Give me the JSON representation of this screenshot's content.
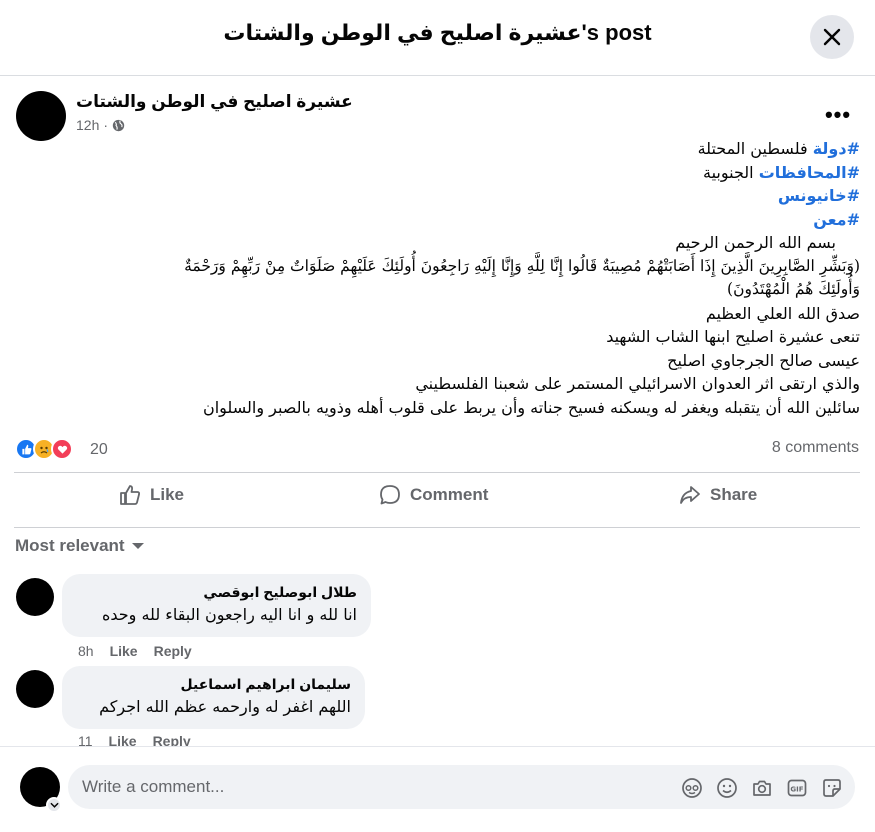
{
  "header": {
    "title": "عشيرة اصليح في الوطن والشتات's post"
  },
  "post": {
    "author": "عشيرة اصليح في الوطن والشتات",
    "time": "12h",
    "hashtags": [
      "#دولة",
      "#المحافظات",
      "#خانيونس",
      "#معن"
    ],
    "hashtag_suffix": [
      " فلسطين المحتلة",
      " الجنوبية",
      "",
      ""
    ],
    "lines": [
      "بسم الله الرحمن الرحيم",
      "(وَبَشِّرِ الصَّابِرِينَ الَّذِينَ إِذَا أَصَابَتْهُمْ مُصِيبَةٌ قَالُوا إِنَّا لِلَّهِ وَإِنَّا إِلَيْهِ رَاجِعُونَ أُولَئِكَ عَلَيْهِمْ صَلَوَاتٌ مِنْ رَبِّهِمْ وَرَحْمَةٌ",
      "وَأُولَئِكَ هُمُ الْمُهْتَدُونَ)",
      "صدق الله العلي العظيم",
      "تنعى  عشيرة اصليح ابنها الشاب الشهيد",
      "عيسى صالح  الجرجاوي اصليح",
      "والذي ارتقى اثر العدوان الاسرائيلي المستمر على شعبنا الفلسطيني",
      "سائلين الله أن يتقبله  ويغفر له ويسكنه فسيح جناته  وأن يربط على قلوب أهله وذويه بالصبر والسلوان"
    ]
  },
  "stats": {
    "reactions": "20",
    "comments": "8 comments"
  },
  "actions": {
    "like": "Like",
    "comment": "Comment",
    "share": "Share"
  },
  "sort_label": "Most relevant",
  "comments": [
    {
      "name": "طلال ابوصليح ابوقصي",
      "text": "انا لله و انا اليه راجعون البقاء لله وحده",
      "time": "8h",
      "like": "Like",
      "reply": "Reply"
    },
    {
      "name": "سليمان ابراهيم اسماعيل",
      "text": "اللهم اغفر له وارحمه عظم الله اجركم",
      "time": "11",
      "like": "Like",
      "reply": "Reply"
    }
  ],
  "composer": {
    "placeholder": "Write a comment..."
  },
  "colors": {
    "link": "#216fdb",
    "like_blue": "#1877f2",
    "love_red": "#f33e58",
    "sad_yellow": "#f7b125"
  }
}
